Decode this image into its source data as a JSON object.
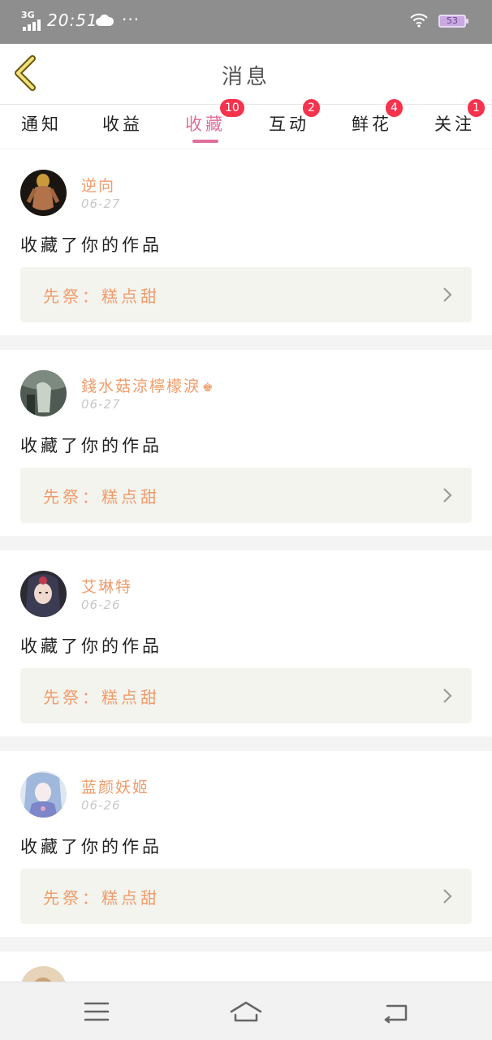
{
  "status_bar": {
    "network": "3G",
    "time": "20:51",
    "weather_icon": "cloud-icon",
    "more": "···",
    "battery_level": "53"
  },
  "header": {
    "title": "消息",
    "back_icon": "chevron-left-icon"
  },
  "tabs": [
    {
      "label": "通知",
      "badge": ""
    },
    {
      "label": "收益",
      "badge": ""
    },
    {
      "label": "收藏",
      "badge": "10",
      "active": true
    },
    {
      "label": "互动",
      "badge": "2"
    },
    {
      "label": "鲜花",
      "badge": "4"
    },
    {
      "label": "关注",
      "badge": "1"
    }
  ],
  "notifications": [
    {
      "username": "逆向",
      "date": "06-27",
      "action": "收藏了你的作品",
      "work_title": "先祭：糕点甜"
    },
    {
      "username": "錢水菇涼檸檬淚",
      "date": "06-27",
      "action": "收藏了你的作品",
      "work_title": "先祭：糕点甜",
      "crown": "♚"
    },
    {
      "username": "艾琳特",
      "date": "06-26",
      "action": "收藏了你的作品",
      "work_title": "先祭：糕点甜"
    },
    {
      "username": "蓝颜妖姬",
      "date": "06-26",
      "action": "收藏了你的作品",
      "work_title": "先祭：糕点甜"
    }
  ],
  "colors": {
    "accent_pink": "#e06f9c",
    "username_orange": "#ee9c6a",
    "badge_red": "#f5334d",
    "status_bar_gray": "#8e8e8e"
  },
  "nav_icons": [
    "menu-icon",
    "home-icon",
    "back-icon"
  ]
}
